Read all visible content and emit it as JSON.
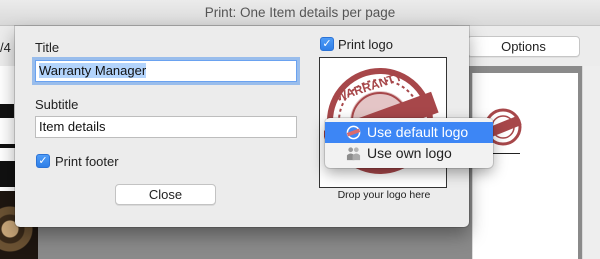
{
  "window": {
    "title": "Print: One Item details per page",
    "page_indicator": "/4",
    "options_label": "Options"
  },
  "sheet": {
    "title_label": "Title",
    "title_value": "Warranty Manager",
    "subtitle_label": "Subtitle",
    "subtitle_value": "Item details",
    "print_footer_label": "Print footer",
    "print_footer_checked": true,
    "close_label": "Close",
    "print_logo_label": "Print logo",
    "print_logo_checked": true,
    "drop_caption": "Drop your logo here",
    "logo_icon": "warranty-stamp-icon"
  },
  "menu": {
    "items": [
      {
        "label": "Use default logo",
        "icon": "default-logo-icon",
        "active": true
      },
      {
        "label": "Use own logo",
        "icon": "own-logo-icon",
        "active": false
      }
    ]
  },
  "colors": {
    "accent": "#3d86f5",
    "stamp": "#a7474a"
  }
}
